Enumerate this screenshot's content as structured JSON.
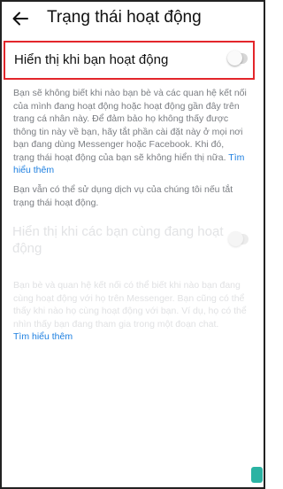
{
  "header": {
    "title": "Trạng thái hoạt động",
    "back_icon": "arrow-left-icon"
  },
  "active_status": {
    "label": "Hiển thị khi bạn hoạt động",
    "enabled": false
  },
  "description1": {
    "text": "Bạn sẽ không biết khi nào bạn bè và các quan hệ kết nối của mình đang hoạt động hoặc hoạt động gần đây trên trang cá nhân này. Để đảm bảo họ không thấy được thông tin này về bạn, hãy tắt phần cài đặt này ở mọi nơi bạn đang dùng Messenger hoặc Facebook. Khi đó, trạng thái hoạt động của bạn sẽ không hiển thị nữa.",
    "link": "Tìm hiểu thêm"
  },
  "description2": {
    "text": "Bạn vẫn có thể sử dụng dịch vụ của chúng tôi nếu tắt trạng thái hoạt động."
  },
  "together_status": {
    "label": "Hiển thị khi các bạn cùng đang hoạt động",
    "enabled": false
  },
  "description3": {
    "text": "Bạn bè và quan hệ kết nối có thể biết khi nào bạn đang cùng hoạt động với họ trên Messenger. Bạn cũng có thể thấy khi nào họ cùng hoạt động với bạn. Ví dụ, họ có thể nhìn thấy bạn đang tham gia trong một đoạn chat.",
    "link": "Tìm hiểu thêm"
  },
  "colors": {
    "highlight_border": "#e3262b",
    "link": "#1d7fe0",
    "corner_logo": "#2bb3a3"
  }
}
